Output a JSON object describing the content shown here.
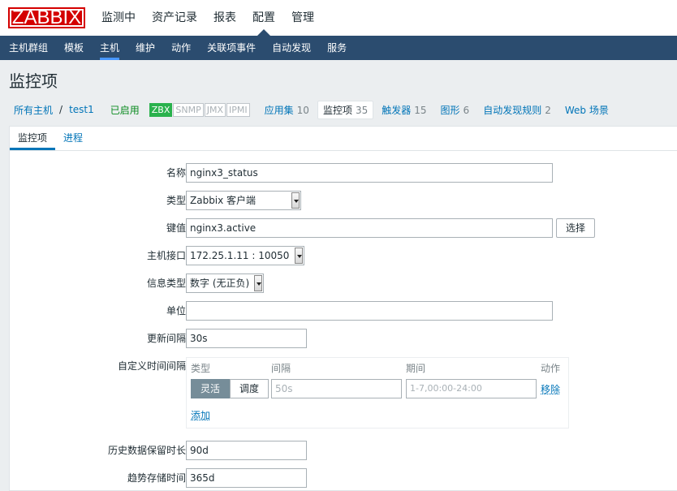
{
  "logo": "ZABBIX",
  "topmenu": [
    "监测中",
    "资产记录",
    "报表",
    "配置",
    "管理"
  ],
  "submenu": [
    "主机群组",
    "模板",
    "主机",
    "维护",
    "动作",
    "关联项事件",
    "自动发现",
    "服务"
  ],
  "page_title": "监控项",
  "hostnav": {
    "all_hosts": "所有主机",
    "sep": "/",
    "host": "test1",
    "status": "已启用",
    "badges": [
      "ZBX",
      "SNMP",
      "JMX",
      "IPMI"
    ],
    "tabs": [
      {
        "label": "应用集",
        "count": "10"
      },
      {
        "label": "监控项",
        "count": "35"
      },
      {
        "label": "触发器",
        "count": "15"
      },
      {
        "label": "图形",
        "count": "6"
      },
      {
        "label": "自动发现规则",
        "count": "2"
      },
      {
        "label": "Web 场景",
        "count": ""
      }
    ]
  },
  "form_tabs": [
    "监控项",
    "进程"
  ],
  "form": {
    "name_label": "名称",
    "name_value": "nginx3_status",
    "type_label": "类型",
    "type_value": "Zabbix 客户端",
    "key_label": "键值",
    "key_value": "nginx3.active",
    "select_button": "选择",
    "interface_label": "主机接口",
    "interface_value": "172.25.1.11 : 10050",
    "info_label": "信息类型",
    "info_value": "数字 (无正负)",
    "unit_label": "单位",
    "unit_value": "",
    "interval_label": "更新间隔",
    "interval_value": "30s",
    "custom_label": "自定义时间间隔",
    "custom": {
      "col_type": "类型",
      "col_interval": "间隔",
      "col_period": "期间",
      "col_action": "动作",
      "seg_flexible": "灵活",
      "seg_scheduling": "调度",
      "interval_placeholder": "50s",
      "period_placeholder": "1-7,00:00-24:00",
      "remove": "移除",
      "add": "添加"
    },
    "history_label": "历史数据保留时长",
    "history_value": "90d",
    "trends_label": "趋势存储时间",
    "trends_value": "365d"
  }
}
